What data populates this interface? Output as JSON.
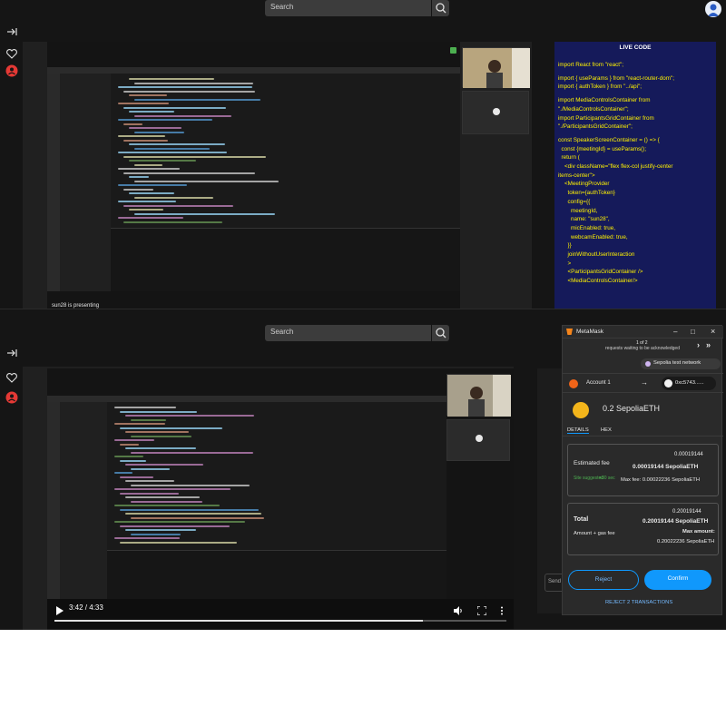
{
  "search": {
    "placeholder": "Search"
  },
  "live_code": {
    "title": "LIVE CODE",
    "lines": [
      "import React from \"react\";",
      "",
      "import { useParams } from \"react-router-dom\";",
      "import { authToken } from \"../api\";",
      "",
      "import MediaControlsContainer from",
      "\"./MediaControlsContainer\";",
      "import ParticipantsGridContainer from",
      "\"./ParticipantsGridContainer\";",
      "",
      "const SpeakerScreenContainer = () => {",
      "  const {meetingId} = useParams();",
      "  return (",
      "    <div className=\"flex flex-col justify-center",
      "items-center\">",
      "    <MeetingProvider",
      "      token={authToken}",
      "      config={{",
      "        meetingId,",
      "        name: \"sun28\",",
      "        micEnabled: true,",
      "        webcamEnabled: true,",
      "      }}",
      "      joinWithoutUserInteraction",
      "      >",
      "      <ParticipantsGridContainer />",
      "      <MediaControlsContainer/>"
    ]
  },
  "presenter": {
    "status": "sun28 is presenting"
  },
  "player": {
    "time": "3:42 / 4:33",
    "progress": 0.815
  },
  "metamask": {
    "title": "MetaMask",
    "queue": "1 of 2",
    "queue_sub": "requests waiting to be acknowledged",
    "network": "Sepolia test network",
    "account": "Account 1",
    "address": "0xc5743......",
    "amount": "0.2 SepoliaETH",
    "tabs": [
      "DETAILS",
      "HEX"
    ],
    "estimated_fee_label": "Estimated fee",
    "estimated_fee_small": "0.00019144",
    "estimated_fee": "0.00019144 SepoliaETH",
    "site_suggested": "Site suggested",
    "likely": "<30 sec",
    "max_fee": "Max fee: 0.00022236 SepoliaETH",
    "total_label": "Total",
    "total_small": "0.20019144",
    "total": "0.20019144 SepoliaETH",
    "amount_gas": "Amount + gas fee",
    "max_amount_label": "Max amount:",
    "max_amount": "0.20022236 SepoliaETH",
    "reject": "Reject",
    "confirm": "Confirm",
    "reject_all": "REJECT 2 TRANSACTIONS"
  },
  "colors": {
    "live_bg": "#151a5a",
    "live_text": "#fff200",
    "confirm": "#1098fc",
    "reject": "#1098fc"
  }
}
